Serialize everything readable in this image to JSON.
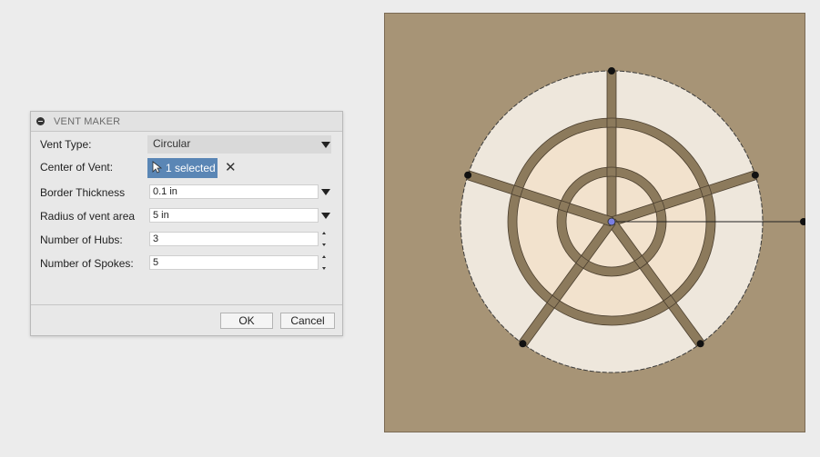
{
  "dialog": {
    "title": "VENT MAKER",
    "fields": {
      "vent_type": {
        "label": "Vent Type:",
        "value": "Circular"
      },
      "center": {
        "label": "Center of Vent:",
        "value": "1 selected"
      },
      "border": {
        "label": "Border Thickness",
        "value": "0.1 in"
      },
      "radius": {
        "label": "Radius of vent area",
        "value": "5 in"
      },
      "hubs": {
        "label": "Number of Hubs:",
        "value": "3"
      },
      "spokes": {
        "label": "Number of Spokes:",
        "value": "5"
      }
    },
    "ok_label": "OK",
    "cancel_label": "Cancel"
  },
  "icons": {
    "collapse": "collapse-icon",
    "cursor": "pointer-cursor-icon",
    "clear": "close-icon",
    "dropdown": "triangle-down-icon",
    "spinner": "spinner-arrows-icon"
  },
  "colors": {
    "selection": "#5a86b5",
    "canvas_bg": "#a79476",
    "outer_ring": "#eee7dc",
    "inner_area": "#f2e2cd",
    "rib": "#8c7a5c",
    "manipulator_point": "#7b7fe3"
  },
  "viewport": {
    "hubs": 3,
    "spokes": 5,
    "handles": 5
  }
}
